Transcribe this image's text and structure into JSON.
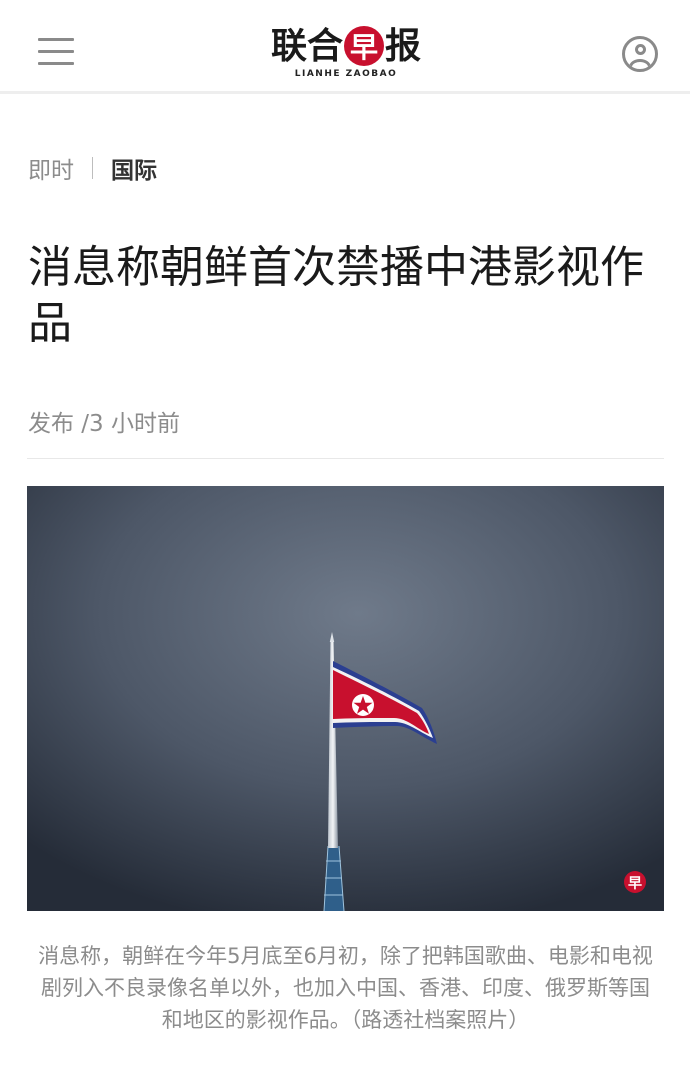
{
  "header": {
    "logo_chars": [
      "联",
      "合",
      "早",
      "报"
    ],
    "logo_en": "LIANHE ZAOBAO",
    "brand_color": "#c8102e",
    "menu_icon": "hamburger-menu-icon",
    "user_icon": "user-account-icon"
  },
  "breadcrumb": {
    "section": "即时",
    "category": "国际"
  },
  "article": {
    "title": "消息称朝鲜首次禁播中港影视作品",
    "published": "发布 /3 小时前",
    "caption": "消息称，朝鲜在今年5月底至6月初，除了把韩国歌曲、电影和电视剧列入不良录像名单以外，也加入中国、香港、印度、俄罗斯等国和地区的影视作品。（路透社档案照片）",
    "watermark": "早"
  }
}
